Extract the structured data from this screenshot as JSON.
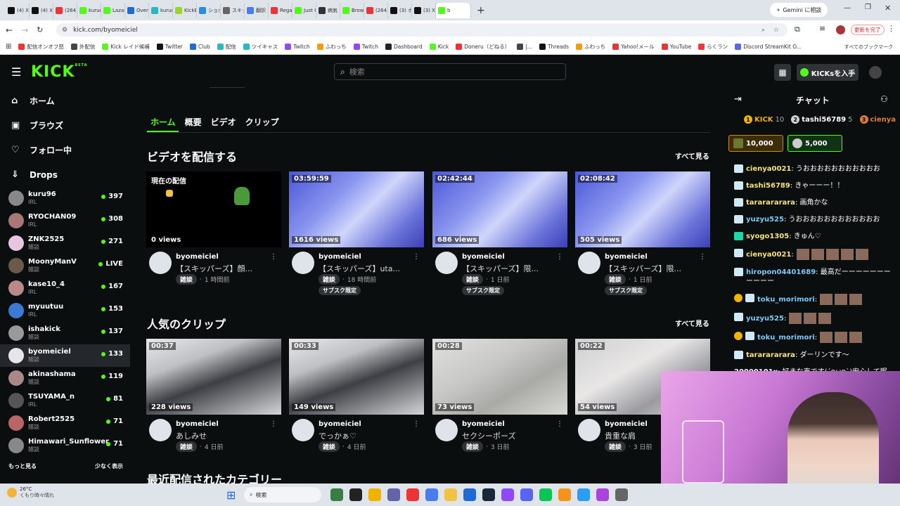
{
  "browser": {
    "tabs": [
      "(4) X",
      "(4) X",
      "(264)",
      "kurumi",
      "Lazar",
      "Overa",
      "kurumi",
      "KickB",
      "ショボ",
      "スキッ",
      "翻訳",
      "Regar",
      "Just C",
      "病気",
      "Brows",
      "(264)",
      "(3) ホ",
      "(3) X",
      "b"
    ],
    "new_tab": "+",
    "gemini": "Gemini に相談",
    "url": "kick.com/byomeiciel",
    "update_btn": "更新を完了",
    "bookmarks": [
      "配信オンオフ怒",
      "外配信",
      "Kick レイド候補",
      "Twitter",
      "Club",
      "配信",
      "ツイキャス",
      "Twitch",
      "ふわっち",
      "Twitch",
      "Dashboard",
      "Kick",
      "Doneru（どねる）",
      "|...",
      "Threads",
      "ふわっち",
      "Yahoo!メール",
      "YouTube",
      "らくラン",
      "Discord StreamKit O..."
    ],
    "all_bookmarks": "すべてのブックマーク"
  },
  "header": {
    "logo": "KICK",
    "logo_sup": "BETA",
    "search_placeholder": "検索",
    "get_kicks": "KICKsを入手"
  },
  "sidebar": {
    "nav": [
      {
        "label": "ホーム"
      },
      {
        "label": "ブラウズ"
      },
      {
        "label": "フォロー中"
      },
      {
        "label": "Drops"
      }
    ],
    "channels": [
      {
        "name": "kuru96",
        "cat": "IRL",
        "viewers": "397"
      },
      {
        "name": "RYOCHAN09",
        "cat": "IRL",
        "viewers": "308"
      },
      {
        "name": "ZNK2525",
        "cat": "雑談",
        "viewers": "271"
      },
      {
        "name": "MoonyManV",
        "cat": "雑談",
        "viewers": "LIVE"
      },
      {
        "name": "kase10_4",
        "cat": "IRL",
        "viewers": "167"
      },
      {
        "name": "myuutuu",
        "cat": "IRL",
        "viewers": "153"
      },
      {
        "name": "ishakick",
        "cat": "雑談",
        "viewers": "137"
      },
      {
        "name": "byomeiciel",
        "cat": "雑談",
        "viewers": "133"
      },
      {
        "name": "akinashama",
        "cat": "雑談",
        "viewers": "119"
      },
      {
        "name": "TSUYAMA_n",
        "cat": "IRL",
        "viewers": "81"
      },
      {
        "name": "Robert2525",
        "cat": "雑談",
        "viewers": "71"
      },
      {
        "name": "Himawari_Sunflower",
        "cat": "雑談",
        "viewers": "71"
      }
    ],
    "show_more": "もっと見る",
    "show_less": "少なく表示"
  },
  "main": {
    "tabs": [
      "ホーム",
      "概要",
      "ビデオ",
      "クリップ"
    ],
    "videos_title": "ビデオを配信する",
    "clips_title": "人気のクリップ",
    "categories_title": "最近配信されたカテゴリー",
    "see_all": "すべて見る",
    "videos": [
      {
        "duration": "現在の配信",
        "views": "0 views",
        "streamer": "byomeiciel",
        "title": "【スキッパーズ】顔...",
        "tag": "雑談",
        "time": "1 時間前",
        "sub": ""
      },
      {
        "duration": "03:59:59",
        "views": "1616 views",
        "streamer": "byomeiciel",
        "title": "【スキッパーズ】uta...",
        "tag": "雑談",
        "time": "18 時間前",
        "sub": "サブスク限定"
      },
      {
        "duration": "02:42:44",
        "views": "686 views",
        "streamer": "byomeiciel",
        "title": "【スキッパーズ】限...",
        "tag": "雑談",
        "time": "1 日前",
        "sub": "サブスク限定"
      },
      {
        "duration": "02:08:42",
        "views": "505 views",
        "streamer": "byomeiciel",
        "title": "【スキッパーズ】限...",
        "tag": "雑談",
        "time": "1 日前",
        "sub": "サブスク限定"
      }
    ],
    "clips": [
      {
        "duration": "00:37",
        "views": "228 views",
        "streamer": "byomeiciel",
        "title": "あしみせ",
        "tag": "雑談",
        "time": "4 日前"
      },
      {
        "duration": "00:33",
        "views": "149 views",
        "streamer": "byomeiciel",
        "title": "でっかぁ♡",
        "tag": "雑談",
        "time": "4 日前"
      },
      {
        "duration": "00:28",
        "views": "73 views",
        "streamer": "byomeiciel",
        "title": "セクシーポーズ",
        "tag": "雑談",
        "time": "3 日前"
      },
      {
        "duration": "00:22",
        "views": "54 views",
        "streamer": "byomeiciel",
        "title": "貴重な肩",
        "tag": "雑談",
        "time": "3 日前"
      }
    ]
  },
  "chat": {
    "title": "チャット",
    "leaders": [
      {
        "rank": "1",
        "name": "KICK",
        "count": "10"
      },
      {
        "rank": "2",
        "name": "tashi56789",
        "count": "5"
      },
      {
        "rank": "3",
        "name": "cienya",
        "count": ""
      }
    ],
    "gifts": [
      "10,000",
      "5,000"
    ],
    "messages": [
      {
        "user": "cienya0021",
        "text": ": うおおおおおおおおおおお",
        "color": "#f8e27c"
      },
      {
        "user": "tashi56789",
        "text": ": きゃーーー！！",
        "color": "#f8e27c"
      },
      {
        "user": "tararararara",
        "text": ": 画角かな",
        "color": "#f8e27c"
      },
      {
        "user": "yuzyu525",
        "text": ": うおおおおおおおおおおおお",
        "color": "#7cc9f8"
      },
      {
        "user": "syogo1305",
        "text": ": きゅん♡",
        "color": "#f8e27c"
      },
      {
        "user": "cienya0021",
        "text": ":",
        "color": "#f8e27c"
      },
      {
        "user": "hiropon04401689",
        "text": ": 最高だーーーーーーーーーーー",
        "color": "#7cc9f8"
      },
      {
        "user": "toku_morimori",
        "text": ":",
        "color": "#7cc9f8"
      },
      {
        "user": "yuzyu525",
        "text": ":",
        "color": "#7cc9f8"
      },
      {
        "user": "toku_morimori",
        "text": ":",
        "color": "#7cc9f8"
      },
      {
        "user": "tararararara",
        "text": ": ダーリンです〜",
        "color": "#f8e27c"
      },
      {
        "user": "20000101x",
        "text": ": 好きな声です(´ฅωฅ`)安心して眠",
        "color": "#ffffff"
      }
    ]
  },
  "taskbar": {
    "weather_temp": "26°C",
    "weather_desc": "くもり時々晴れ",
    "search": "検索"
  }
}
